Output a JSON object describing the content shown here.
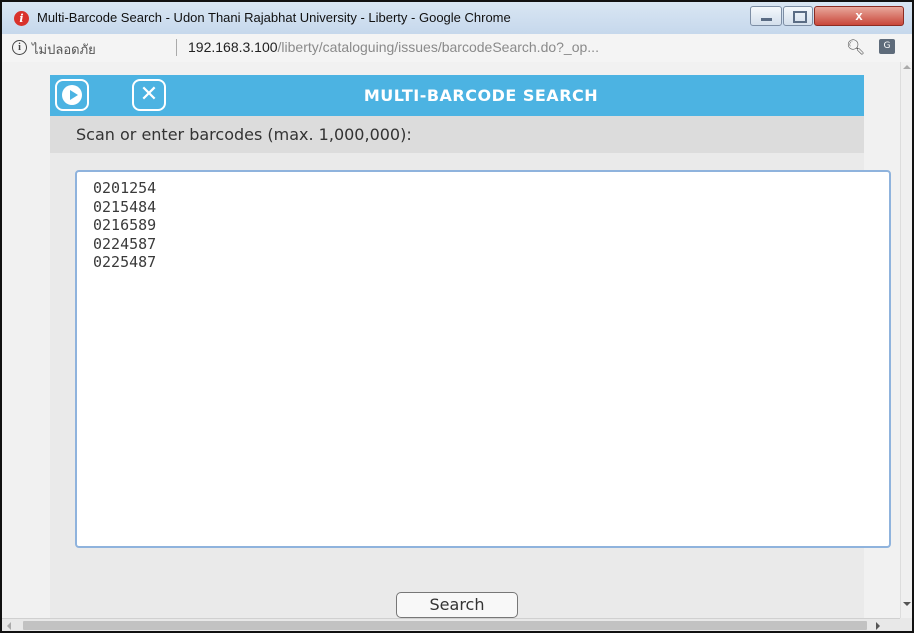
{
  "window": {
    "title": "Multi-Barcode Search - Udon Thani Rajabhat University - Liberty - Google Chrome",
    "close_glyph": "x"
  },
  "address_bar": {
    "security_label": "ไม่ปลอดภัย",
    "host": "192.168.3.100",
    "path": "/liberty/cataloguing/issues/barcodeSearch.do?_op...",
    "icons": [
      "info-icon",
      "zoom-icon",
      "translate-icon"
    ]
  },
  "dialog": {
    "title": "MULTI-BARCODE SEARCH",
    "prompt": "Scan or enter barcodes (max. 1,000,000):",
    "barcodes_text": "0201254\n0215484\n0216589\n0224587\n0225487\n",
    "search_label": "Search",
    "play_icon": "play-icon",
    "close_icon": "close-icon"
  },
  "colors": {
    "header": "#4cb3e2",
    "textarea_border": "#8fb3dd"
  }
}
